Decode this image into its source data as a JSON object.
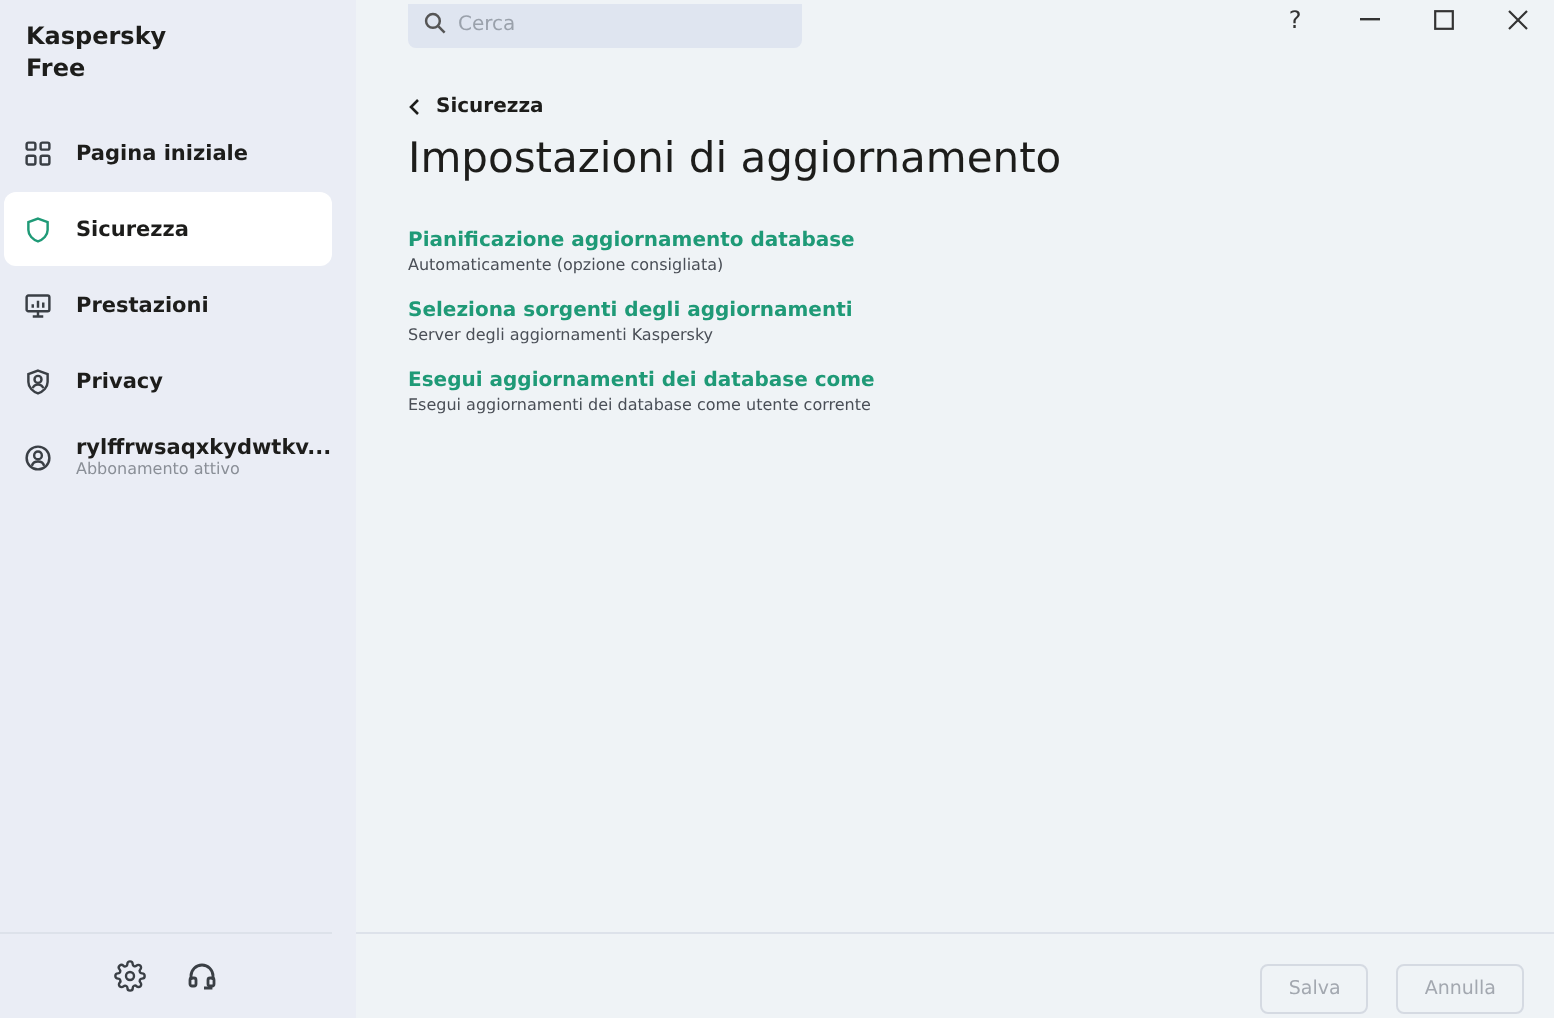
{
  "app": {
    "name_line_1": "Kaspersky",
    "name_line_2": "Free"
  },
  "sidebar": {
    "items": [
      {
        "kind": "home",
        "label": "Pagina iniziale",
        "selected": false
      },
      {
        "kind": "shield",
        "label": "Sicurezza",
        "selected": true
      },
      {
        "kind": "monitor",
        "label": "Prestazioni",
        "selected": false
      },
      {
        "kind": "privacy",
        "label": "Privacy",
        "selected": false
      },
      {
        "kind": "account",
        "label": "rylffrwsaqxkydwtkv...",
        "sublabel": "Abbonamento attivo",
        "selected": false
      }
    ]
  },
  "search": {
    "placeholder": "Cerca"
  },
  "window_controls": [
    "?"
  ],
  "breadcrumb": {
    "label": "Sicurezza"
  },
  "page_title": "Impostazioni di aggiornamento",
  "settings": [
    {
      "title": "Pianificazione aggiornamento database",
      "description": "Automaticamente (opzione consigliata)"
    },
    {
      "title": "Seleziona sorgenti degli aggiornamenti",
      "description": "Server degli aggiornamenti Kaspersky"
    },
    {
      "title": "Esegui aggiornamenti dei database come",
      "description": "Esegui aggiornamenti dei database come utente corrente"
    }
  ],
  "footer_buttons": [
    {
      "label": "Salva",
      "disabled": true
    },
    {
      "label": "Annulla",
      "disabled": true
    }
  ]
}
